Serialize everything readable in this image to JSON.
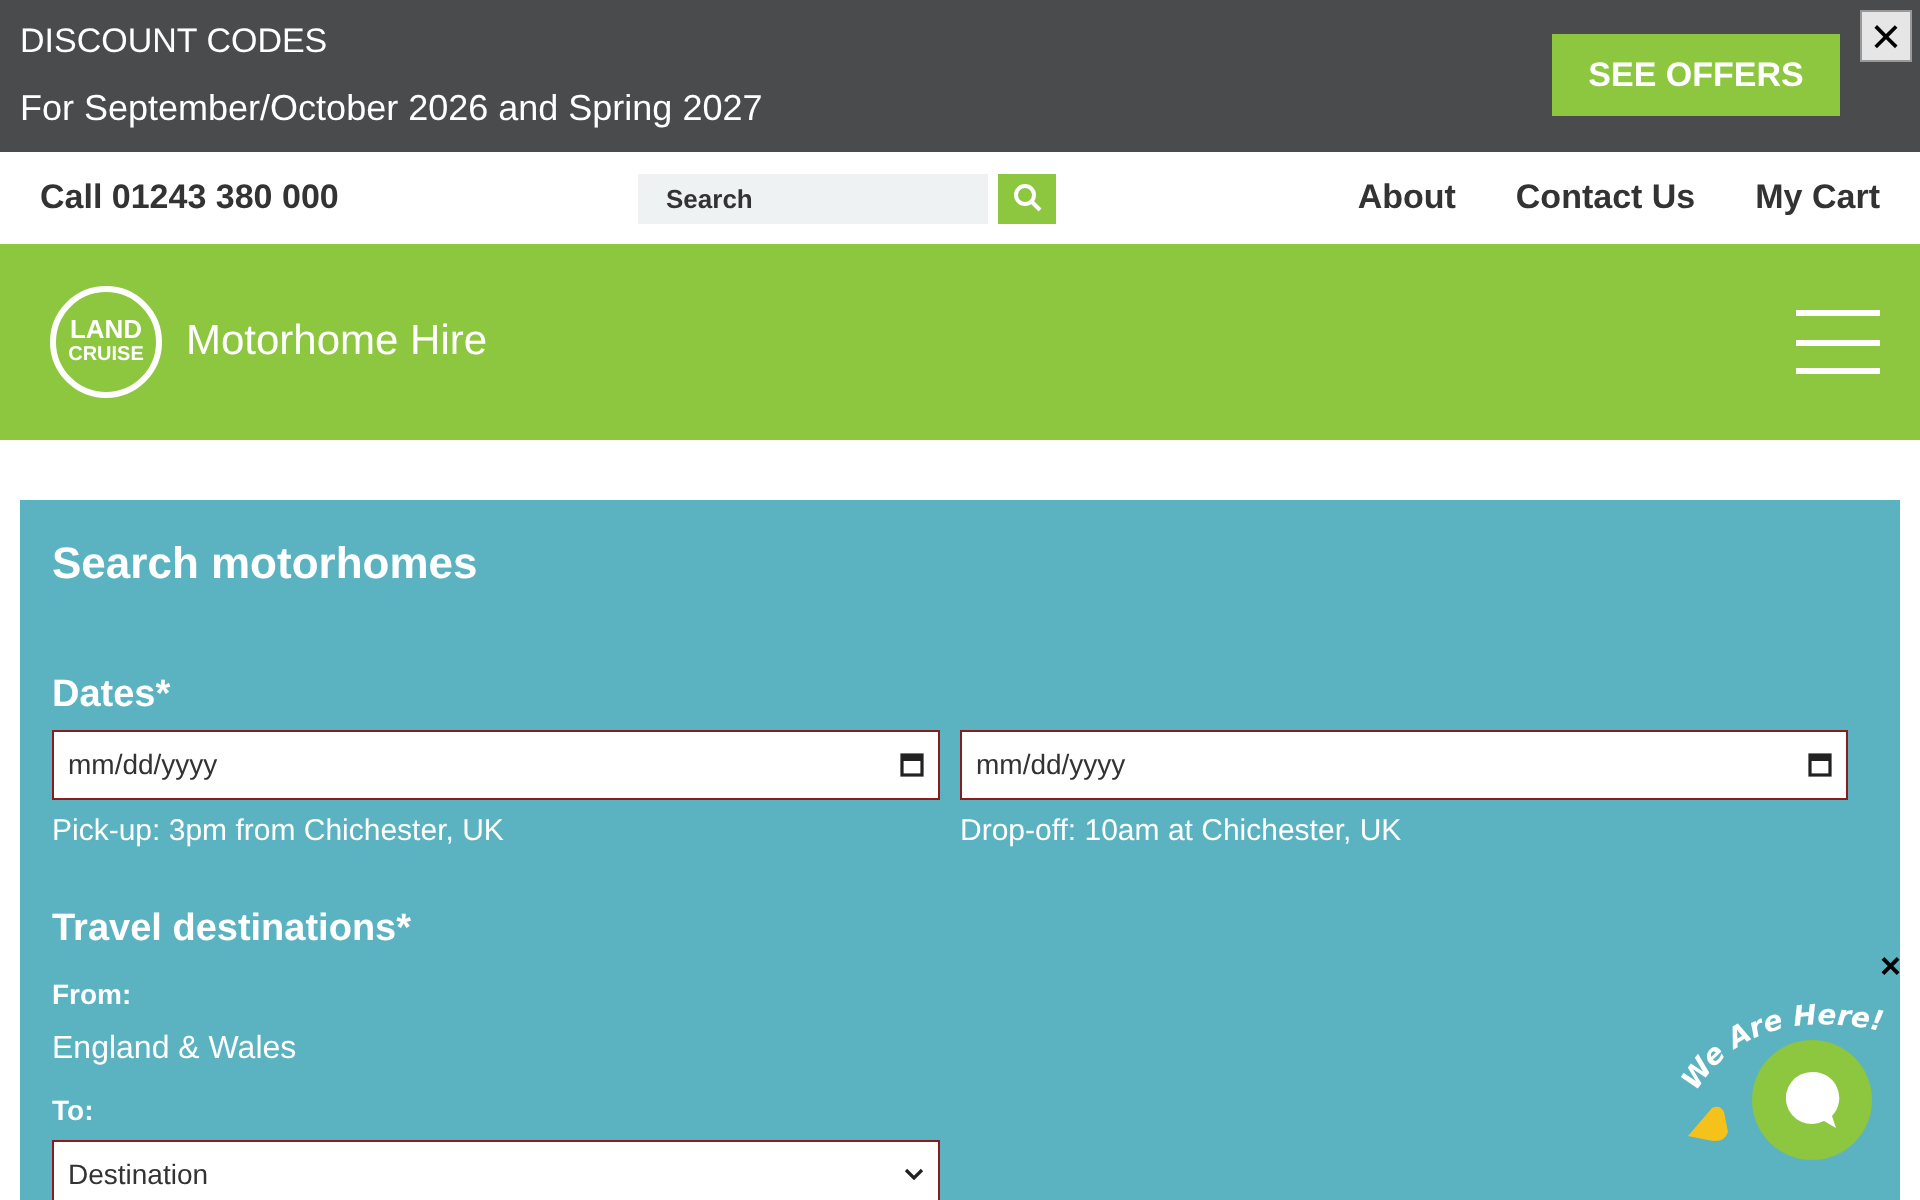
{
  "promo_bar": {
    "title": "DISCOUNT CODES",
    "subtitle": "For September/October 2026 and Spring 2027",
    "button": "SEE OFFERS",
    "close": "×"
  },
  "top_nav": {
    "phone": "Call 01243 380 000",
    "search": {
      "placeholder": "Search"
    },
    "links": [
      "About",
      "Contact Us",
      "My Cart"
    ]
  },
  "header": {
    "logo": [
      "LAND",
      "CRUISE"
    ],
    "title": "Motorhome Hire"
  },
  "search_form": {
    "title": "Search motorhomes",
    "dates": {
      "label": "Dates*",
      "fields": [
        {
          "placeholder": "mm/dd/yyyy",
          "hint": "Pick-up: 3pm from Chichester, UK"
        },
        {
          "placeholder": "mm/dd/yyyy",
          "hint": "Drop-off: 10am at Chichester, UK"
        }
      ]
    },
    "destinations": {
      "label": "Travel destinations*",
      "from_label": "From:",
      "from_value": "England & Wales",
      "to_label": "To:",
      "to_select": "Destination"
    }
  },
  "chat_widget": {
    "greeting": "We Are Here!",
    "close": "×"
  }
}
